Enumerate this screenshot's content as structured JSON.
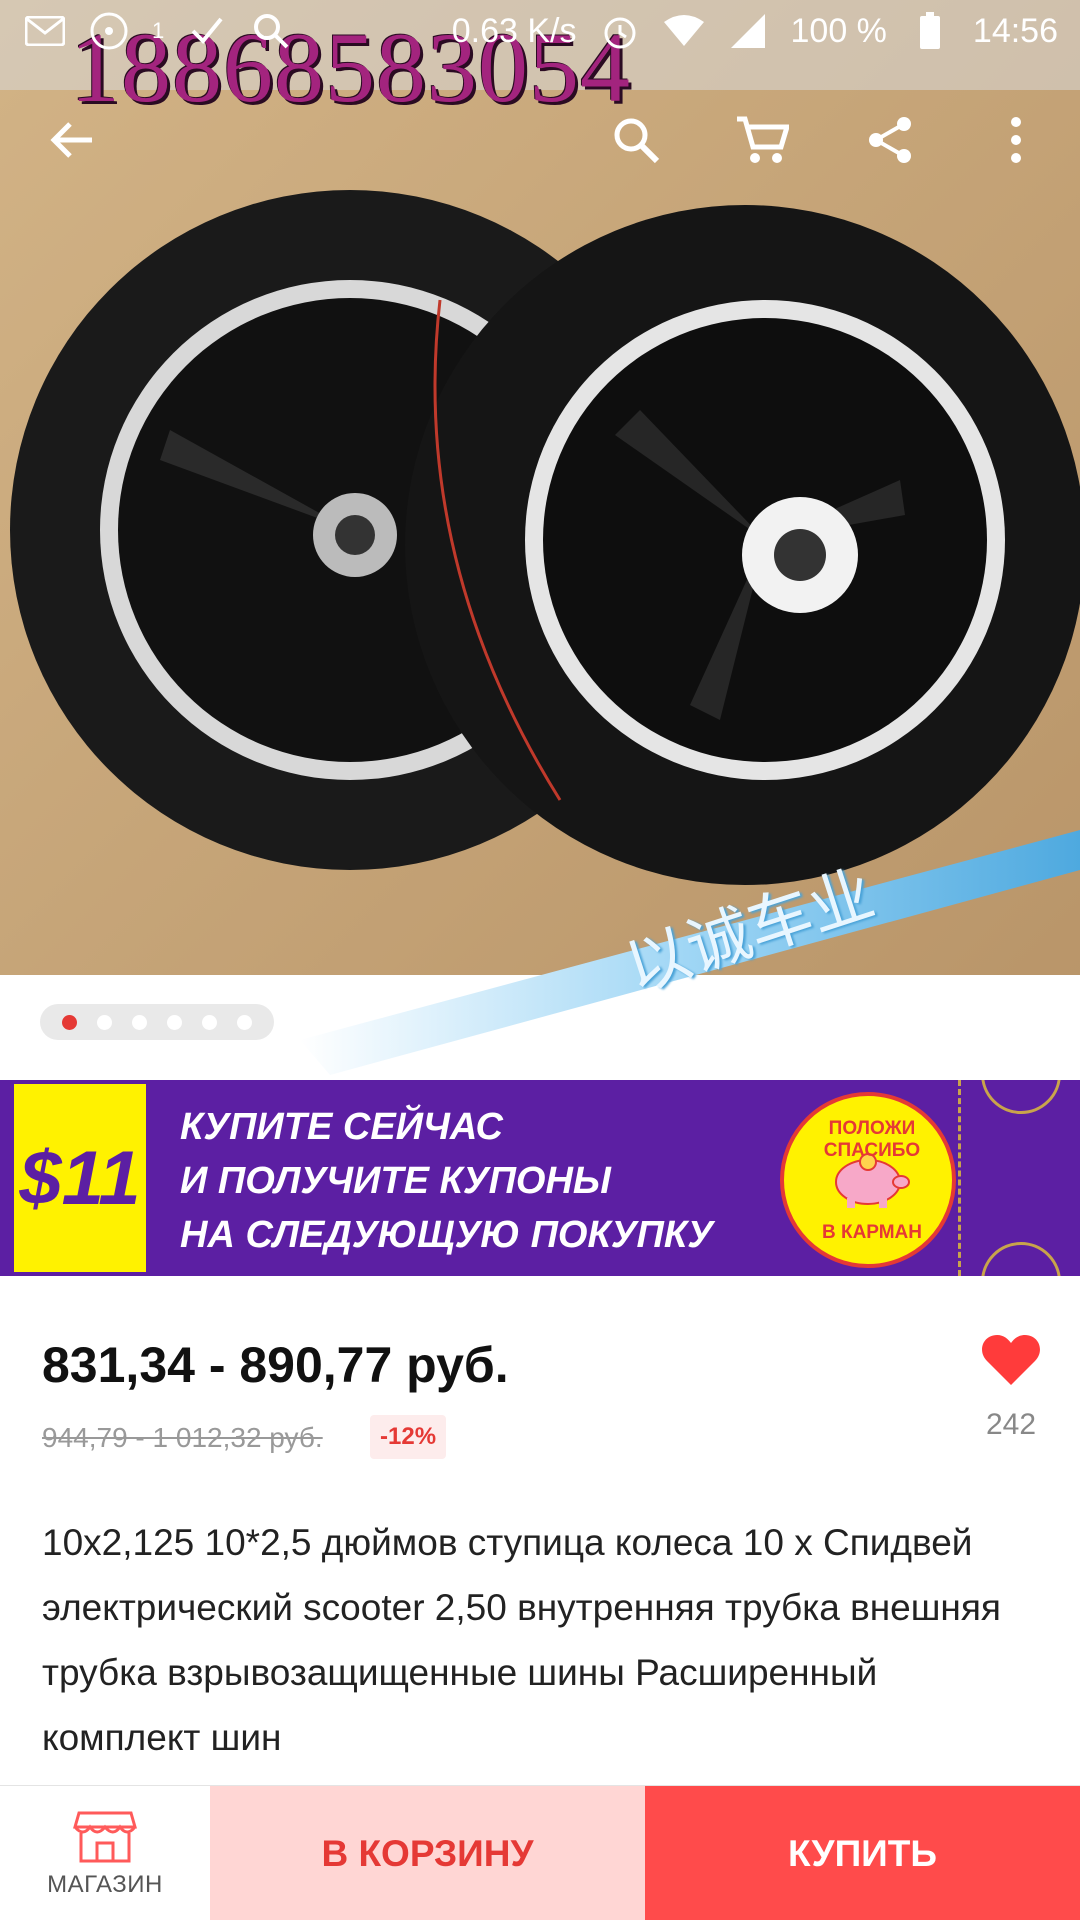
{
  "status_bar": {
    "speed": "0.63 K/s",
    "battery": "100 %",
    "time": "14:56",
    "signal_digit": "1"
  },
  "product_image": {
    "watermark_phone": "18868583054",
    "watermark_text": "以诚车业",
    "dots_total": 6,
    "active_dot": 0
  },
  "promo": {
    "amount": "$11",
    "line1": "КУПИТЕ СЕЙЧАС",
    "line2": "И ПОЛУЧИТЕ КУПОНЫ",
    "line3": "НА СЛЕДУЮЩУЮ ПОКУПКУ",
    "badge_top": "ПОЛОЖИ СПАСИБО",
    "badge_bottom": "В КАРМАН"
  },
  "price": {
    "current": "831,34 - 890,77 руб.",
    "old": "944,79 - 1 012,32 руб.",
    "discount": "-12%"
  },
  "favorites": {
    "count": "242"
  },
  "product": {
    "title": "10x2,125 10*2,5 дюймов ступица колеса 10 x Спидвей электрический scooter 2,50 внутренняя трубка внешняя трубка взрывозащищенные шины Расширенный комплект шин"
  },
  "actions": {
    "shop_label": "МАГАЗИН",
    "cart_label": "В КОРЗИНУ",
    "buy_label": "КУПИТЬ"
  },
  "colors": {
    "accent": "#e53935",
    "banner_purple": "#5c1fa3",
    "banner_yellow": "#fff200"
  }
}
